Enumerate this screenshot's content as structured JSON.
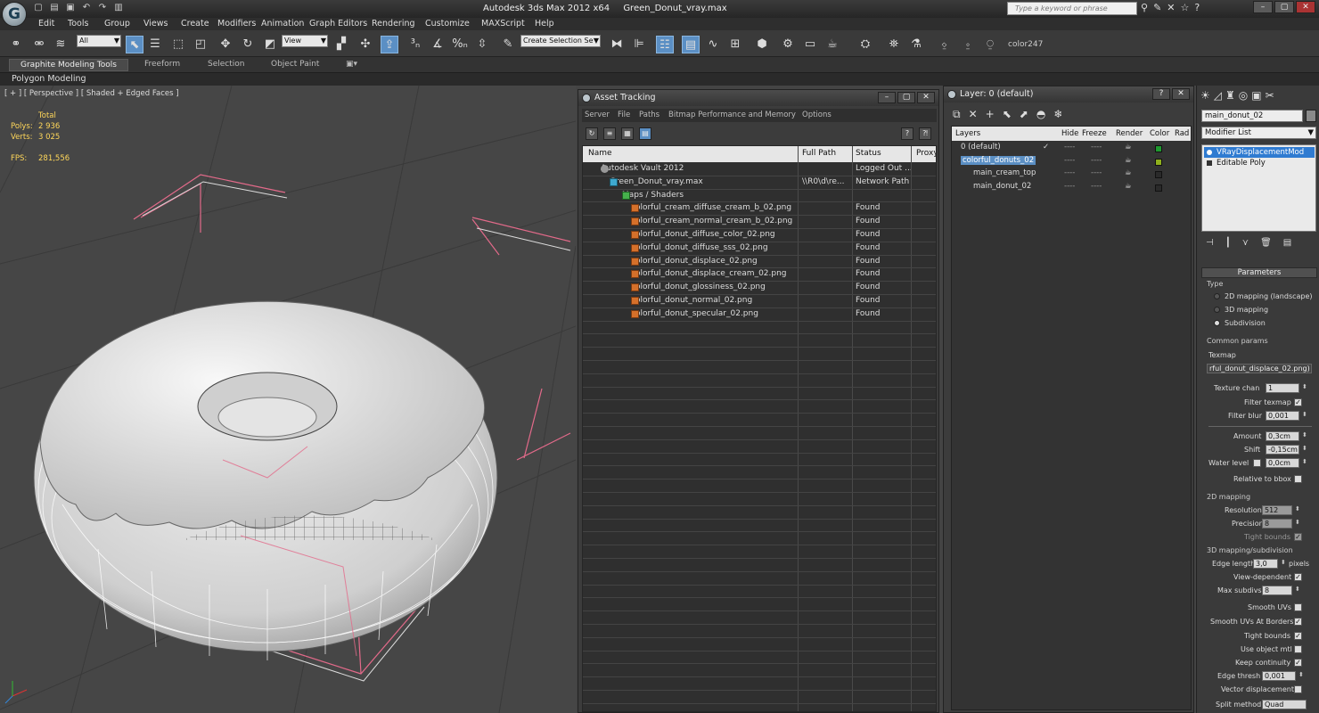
{
  "titlebar": {
    "app_title": "Autodesk 3ds Max  2012 x64",
    "file_name": "Green_Donut_vray.max",
    "search_placeholder": "Type a keyword or phrase",
    "logo_letter": "G"
  },
  "menus": [
    "Edit",
    "Tools",
    "Group",
    "Views",
    "Create",
    "Modifiers",
    "Animation",
    "Graph Editors",
    "Rendering",
    "Customize",
    "MAXScript",
    "Help"
  ],
  "toolbar": {
    "selection_filter": "All",
    "reference_coord": "View",
    "named_selection": "Create Selection Se",
    "color_label": "color247"
  },
  "ribbon": {
    "tabs": [
      "Graphite Modeling Tools",
      "Freeform",
      "Selection",
      "Object Paint"
    ],
    "sub_label": "Polygon Modeling"
  },
  "viewport": {
    "label": "[ + ] [ Perspective ] [ Shaded + Edged Faces ]",
    "stats_header": "Total",
    "polys_label": "Polys:",
    "polys_value": "2 936",
    "verts_label": "Verts:",
    "verts_value": "3 025",
    "fps_label": "FPS:",
    "fps_value": "281,556"
  },
  "asset_tracking": {
    "title": "Asset Tracking",
    "menu": [
      "Server",
      "File",
      "Paths",
      "Bitmap Performance and Memory",
      "Options"
    ],
    "columns": [
      "Name",
      "Full Path",
      "Status",
      "Proxy"
    ],
    "rows": [
      {
        "name": "Autodesk Vault 2012",
        "path": "",
        "status": "Logged Out ...",
        "icon": "vault"
      },
      {
        "name": "Green_Donut_vray.max",
        "path": "\\\\R0\\d\\re...",
        "status": "Network Path",
        "icon": "max"
      },
      {
        "name": "Maps / Shaders",
        "path": "",
        "status": "",
        "icon": "maps"
      },
      {
        "name": "colorful_cream_diffuse_cream_b_02.png",
        "path": "",
        "status": "Found",
        "icon": "png"
      },
      {
        "name": "colorful_cream_normal_cream_b_02.png",
        "path": "",
        "status": "Found",
        "icon": "png"
      },
      {
        "name": "colorful_donut_diffuse_color_02.png",
        "path": "",
        "status": "Found",
        "icon": "png"
      },
      {
        "name": "colorful_donut_diffuse_sss_02.png",
        "path": "",
        "status": "Found",
        "icon": "png"
      },
      {
        "name": "colorful_donut_displace_02.png",
        "path": "",
        "status": "Found",
        "icon": "png"
      },
      {
        "name": "colorful_donut_displace_cream_02.png",
        "path": "",
        "status": "Found",
        "icon": "png"
      },
      {
        "name": "colorful_donut_glossiness_02.png",
        "path": "",
        "status": "Found",
        "icon": "png"
      },
      {
        "name": "colorful_donut_normal_02.png",
        "path": "",
        "status": "Found",
        "icon": "png"
      },
      {
        "name": "colorful_donut_specular_02.png",
        "path": "",
        "status": "Found",
        "icon": "png"
      }
    ]
  },
  "layers": {
    "title": "Layer: 0 (default)",
    "columns": [
      "Layers",
      "Hide",
      "Freeze",
      "Render",
      "Color",
      "Rad"
    ],
    "rows": [
      {
        "name": "0 (default)",
        "hide": "----",
        "freeze": "----",
        "color": "#1f9a2f",
        "active": true
      },
      {
        "name": "colorful_donuts_02",
        "hide": "----",
        "freeze": "----",
        "color": "#8fb01c",
        "selected": true
      },
      {
        "name": "main_cream_top",
        "hide": "----",
        "freeze": "----",
        "color": "#2a2a2a"
      },
      {
        "name": "main_donut_02",
        "hide": "----",
        "freeze": "----",
        "color": "#2a2a2a"
      }
    ]
  },
  "command_panel": {
    "object_name": "main_donut_02",
    "modifier_list": "Modifier List",
    "stack": [
      "VRayDisplacementMod",
      "Editable Poly"
    ],
    "rollout_parameters": "Parameters",
    "type_group": "Type",
    "type_options": [
      "2D mapping (landscape)",
      "3D mapping",
      "Subdivision"
    ],
    "common_group": "Common params",
    "texmap_label": "Texmap",
    "texmap_value": "rful_donut_displace_02.png)",
    "texture_chan_label": "Texture chan",
    "texture_chan_value": "1",
    "filter_texmap_label": "Filter texmap",
    "filter_blur_label": "Filter blur",
    "filter_blur_value": "0,001",
    "amount_label": "Amount",
    "amount_value": "0,3cm",
    "shift_label": "Shift",
    "shift_value": "-0,15cm",
    "water_level_label": "Water level",
    "water_level_value": "0,0cm",
    "relative_bbox_label": "Relative to bbox",
    "mapping2d_group": "2D mapping",
    "resolution_label": "Resolution",
    "resolution_value": "512",
    "precision_label": "Precision",
    "precision_value": "8",
    "tight_bounds_label": "Tight bounds",
    "mapping3d_group": "3D mapping/subdivision",
    "edge_length_label": "Edge length",
    "edge_length_value": "3,0",
    "pixels_label": "pixels",
    "view_dependent_label": "View-dependent",
    "max_subdivs_label": "Max subdivs",
    "max_subdivs_value": "8",
    "smooth_uvs_label": "Smooth UVs",
    "smooth_uvs_borders_label": "Smooth UVs At Borders",
    "tight_bounds2_label": "Tight bounds",
    "use_object_mtl_label": "Use object mtl",
    "keep_continuity_label": "Keep continuity",
    "edge_thresh_label": "Edge thresh",
    "edge_thresh_value": "0,001",
    "vector_disp_label": "Vector displacement",
    "split_method_label": "Split method",
    "split_method_value": "Quad"
  }
}
